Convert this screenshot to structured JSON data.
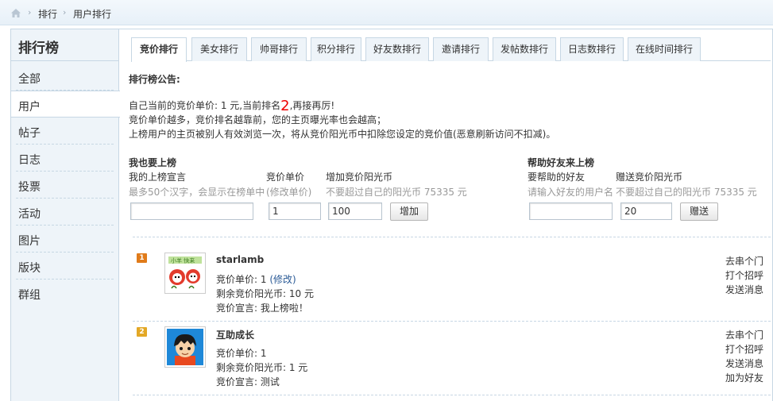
{
  "breadcrumb": {
    "items": [
      "排行",
      "用户排行"
    ]
  },
  "sidebar": {
    "title": "排行榜",
    "items": [
      "全部",
      "用户",
      "帖子",
      "日志",
      "投票",
      "活动",
      "图片",
      "版块",
      "群组"
    ],
    "active_index": 1
  },
  "tabs": [
    {
      "label": "竞价排行"
    },
    {
      "label": "美女排行"
    },
    {
      "label": "帅哥排行"
    },
    {
      "label": "积分排行"
    },
    {
      "label": "好友数排行"
    },
    {
      "label": "邀请排行"
    },
    {
      "label": "发帖数排行"
    },
    {
      "label": "日志数排行"
    },
    {
      "label": "在线时间排行"
    }
  ],
  "notice": {
    "heading": "排行榜公告:",
    "line1_pre": "自己当前的竞价单价: 1 元,当前排名",
    "rank": "2",
    "line1_post": ",再接再厉!",
    "line2": "竞价单价越多，竞价排名越靠前，您的主页曝光率也会越高；",
    "line3": "上榜用户的主页被别人有效浏览一次，将从竞价阳光币中扣除您设定的竞价值(恶意刷新访问不扣减)。"
  },
  "self_form": {
    "heading": "我也要上榜",
    "slogan_label": "我的上榜宣言",
    "slogan_hint": "最多50个汉字，会显示在榜单中",
    "price_label": "竞价单价",
    "price_hint": "(修改单价)",
    "price_value": "1",
    "add_label": "增加竞价阳光币",
    "add_hint": "不要超过自己的阳光币 75335 元",
    "add_value": "100",
    "submit": "增加"
  },
  "friend_form": {
    "heading": "帮助好友来上榜",
    "friend_label": "要帮助的好友",
    "friend_hint": "请输入好友的用户名",
    "gift_label": "赠送竞价阳光币",
    "gift_hint": "不要超过自己的阳光币 75335 元",
    "gift_value": "20",
    "submit": "赠送"
  },
  "entries": [
    {
      "rank": "1",
      "badge_color": "#e07b1a",
      "name": "starlamb",
      "price_pre": "竞价单价: 1 ",
      "price_link": "(修改)",
      "balance": "剩余竞价阳光币: 10 元",
      "slogan": "竞价宣言: 我上榜啦！",
      "actions": [
        "去串个门",
        "打个招呼",
        "发送消息"
      ]
    },
    {
      "rank": "2",
      "badge_color": "#e3a826",
      "name": "互助成长",
      "price_pre": "竞价单价: 1",
      "price_link": "",
      "balance": "剩余竞价阳光币: 1 元",
      "slogan": "竞价宣言: 测试",
      "actions": [
        "去串个门",
        "打个招呼",
        "发送消息",
        "加为好友"
      ]
    }
  ],
  "colors": {
    "accent_red": "#e00000",
    "link_blue": "#2a5a96",
    "border": "#c7d7e4",
    "sidebar_bg": "#eef4f9"
  }
}
